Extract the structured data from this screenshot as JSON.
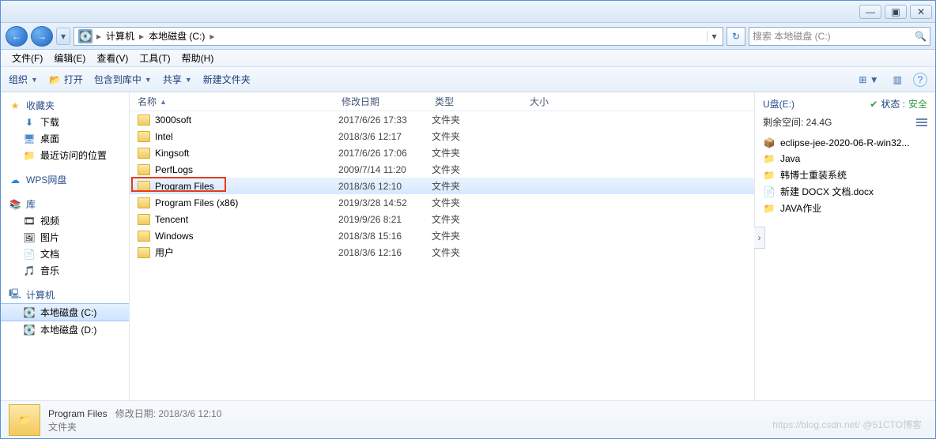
{
  "window": {
    "min": "—",
    "max": "▣",
    "close": "✕"
  },
  "nav": {
    "back": "←",
    "fwd": "→",
    "drop": "▾"
  },
  "address": {
    "segments": [
      "计算机",
      "本地磁盘 (C:)"
    ],
    "arrow": "▸",
    "drop": "▾",
    "refresh": "↻"
  },
  "search": {
    "placeholder": "搜索 本地磁盘 (C:)",
    "icon": "🔍"
  },
  "menubar": [
    "文件(F)",
    "编辑(E)",
    "查看(V)",
    "工具(T)",
    "帮助(H)"
  ],
  "toolbar": {
    "organize": "组织",
    "open": "打开",
    "include": "包含到库中",
    "share": "共享",
    "newfolder": "新建文件夹",
    "drop": "▼",
    "open_icon": "📂",
    "view_icon": "⊞",
    "preview_icon": "▥",
    "help_icon": "?"
  },
  "sidebar": {
    "fav": {
      "label": "收藏夹",
      "icon": "★",
      "items": [
        {
          "label": "下载",
          "icon": "⬇"
        },
        {
          "label": "桌面",
          "icon": "🖥"
        },
        {
          "label": "最近访问的位置",
          "icon": "📁"
        }
      ]
    },
    "wps": {
      "label": "WPS网盘",
      "icon": "☁"
    },
    "lib": {
      "label": "库",
      "icon": "📚",
      "items": [
        {
          "label": "视频",
          "icon": "🎞"
        },
        {
          "label": "图片",
          "icon": "🖼"
        },
        {
          "label": "文档",
          "icon": "📄"
        },
        {
          "label": "音乐",
          "icon": "🎵"
        }
      ]
    },
    "computer": {
      "label": "计算机",
      "icon": "🖳",
      "items": [
        {
          "label": "本地磁盘 (C:)",
          "icon": "💽",
          "selected": true
        },
        {
          "label": "本地磁盘 (D:)",
          "icon": "💽"
        }
      ]
    }
  },
  "columns": {
    "name": "名称",
    "date": "修改日期",
    "type": "类型",
    "size": "大小"
  },
  "files": [
    {
      "name": "3000soft",
      "date": "2017/6/26 17:33",
      "type": "文件夹"
    },
    {
      "name": "Intel",
      "date": "2018/3/6 12:17",
      "type": "文件夹"
    },
    {
      "name": "Kingsoft",
      "date": "2017/6/26 17:06",
      "type": "文件夹"
    },
    {
      "name": "PerfLogs",
      "date": "2009/7/14 11:20",
      "type": "文件夹"
    },
    {
      "name": "Program Files",
      "date": "2018/3/6 12:10",
      "type": "文件夹",
      "selected": true,
      "highlighted": true
    },
    {
      "name": "Program Files (x86)",
      "date": "2019/3/28 14:52",
      "type": "文件夹"
    },
    {
      "name": "Tencent",
      "date": "2019/9/26 8:21",
      "type": "文件夹"
    },
    {
      "name": "Windows",
      "date": "2018/3/8 15:16",
      "type": "文件夹"
    },
    {
      "name": "用户",
      "date": "2018/3/6 12:16",
      "type": "文件夹"
    }
  ],
  "preview": {
    "drive": "U盘(E:)",
    "status_label": "状态 :",
    "status_value": "安全",
    "status_icon": "✔",
    "space": "剩余空间: 24.4G",
    "menu": "≡",
    "items": [
      {
        "label": "eclipse-jee-2020-06-R-win32...",
        "icon": "📦"
      },
      {
        "label": "Java",
        "icon": "📁"
      },
      {
        "label": "韩博士重装系统",
        "icon": "📁"
      },
      {
        "label": "新建 DOCX 文档.docx",
        "icon": "📄"
      },
      {
        "label": "JAVA作业",
        "icon": "📁"
      }
    ],
    "arrow": "›"
  },
  "statusbar": {
    "name": "Program Files",
    "date_label": "修改日期:",
    "date": "2018/3/6 12:10",
    "type": "文件夹"
  },
  "watermark": "https://blog.csdn.net/ @51CTO博客"
}
